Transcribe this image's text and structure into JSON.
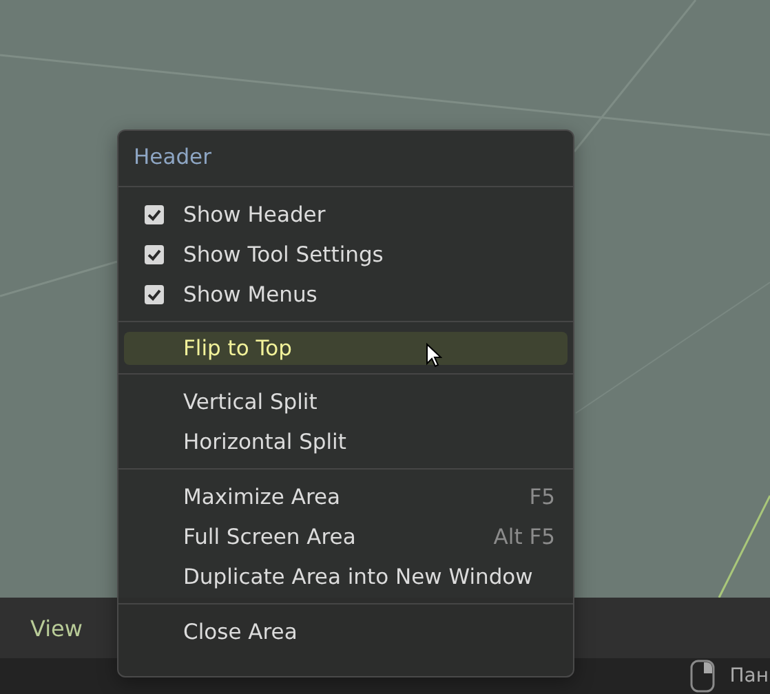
{
  "menu": {
    "title": "Header",
    "sections": [
      [
        {
          "kind": "check",
          "label": "Show Header",
          "checked": true,
          "selected": false
        },
        {
          "kind": "check",
          "label": "Show Tool Settings",
          "checked": true,
          "selected": false
        },
        {
          "kind": "check",
          "label": "Show Menus",
          "checked": true,
          "selected": false
        }
      ],
      [
        {
          "kind": "item",
          "label": "Flip to Top",
          "selected": true
        }
      ],
      [
        {
          "kind": "item",
          "label": "Vertical Split",
          "selected": false
        },
        {
          "kind": "item",
          "label": "Horizontal Split",
          "selected": false
        }
      ],
      [
        {
          "kind": "item",
          "label": "Maximize Area",
          "shortcut": "F5",
          "selected": false
        },
        {
          "kind": "item",
          "label": "Full Screen Area",
          "shortcut": "Alt F5",
          "selected": false
        },
        {
          "kind": "item",
          "label": "Duplicate Area into New Window",
          "selected": false
        }
      ],
      [
        {
          "kind": "item",
          "label": "Close Area",
          "selected": false
        }
      ]
    ]
  },
  "header_bar": {
    "menus": [
      {
        "label": "View"
      }
    ]
  },
  "status_bar": {
    "hint": "Пан"
  }
}
